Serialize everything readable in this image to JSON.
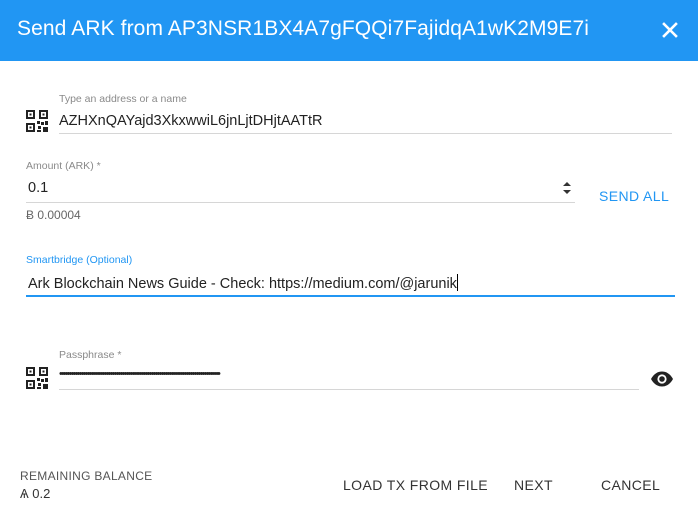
{
  "dialog": {
    "title": "Send ARK from AP3NSR1BX4A7gFQQi7FajidqA1wK2M9E7i"
  },
  "address": {
    "label": "Type an address or a name",
    "value": "AZHXnQAYajd3XkxwwiL6jnLjtDHjtAATtR"
  },
  "amount": {
    "label": "Amount (ARK) *",
    "value": "0.1",
    "fee": "Ƀ 0.00004",
    "send_all": "SEND ALL"
  },
  "smartbridge": {
    "label": "Smartbridge (Optional)",
    "value": "Ark Blockchain News Guide - Check: https://medium.com/@jarunik"
  },
  "passphrase": {
    "label": "Passphrase *",
    "value": "••••••••••••••••••••••••••••••••••••••••••••••••••••••••••••••••••••••••••••••••••"
  },
  "footer": {
    "remaining_label": "REMAINING BALANCE",
    "remaining_value": "Ѧ 0.2",
    "load_tx": "LOAD TX FROM FILE",
    "next": "NEXT",
    "cancel": "CANCEL"
  },
  "colors": {
    "header": "#2196f3",
    "accent": "#2196f3"
  },
  "icons": [
    "close-icon",
    "qr-code-icon",
    "spinner-arrows-icon",
    "eye-icon"
  ]
}
